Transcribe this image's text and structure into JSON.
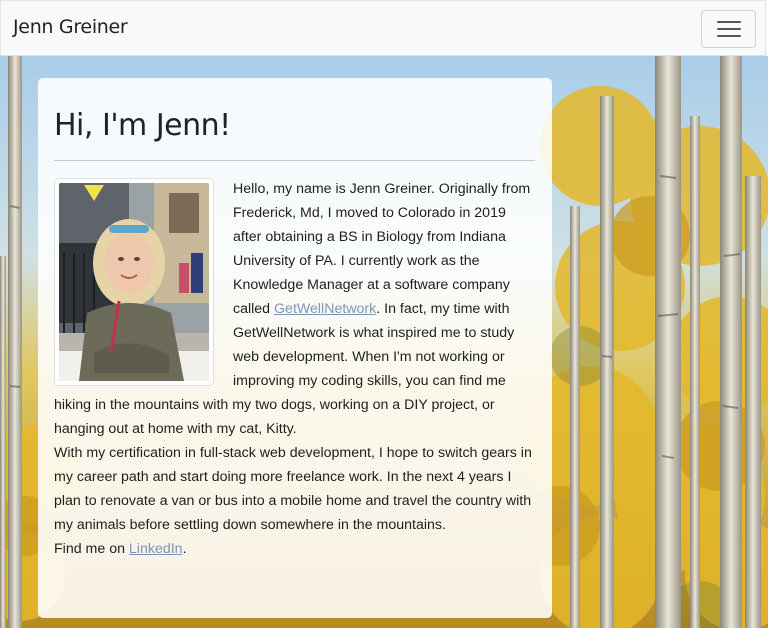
{
  "navbar": {
    "brand": "Jenn Greiner",
    "menu_icon": "hamburger-menu-icon"
  },
  "background": {
    "description_icon": "aspen-forest-background"
  },
  "card": {
    "title": "Hi, I'm Jenn!",
    "photo_icon": "profile-photo",
    "paragraph1_part1": "Hello, my name is Jenn Greiner. Originally from Frederick, Md, I moved to Colorado in 2019 after obtaining a BS in Biology from Indiana University of PA. I currently work as the Knowledge Manager at a software company called ",
    "link_getwell": "GetWellNetwork",
    "paragraph1_part2": ". In fact, my time with GetWellNetwork is what inspired me to study web development. When I'm not working or improving my coding skills, you can find me hiking in the mountains with my two dogs, working on a DIY project, or hanging out at home with my cat, Kitty.",
    "paragraph2": "With my certification in full-stack web development, I hope to switch gears in my career path and start doing more freelance work. In the next 4 years I plan to renovate a van or bus into a mobile home and travel the country with my animals before settling down somewhere in the mountains.",
    "paragraph3_part1": "Find me on ",
    "link_linkedin": "LinkedIn",
    "paragraph3_part2": "."
  },
  "colors": {
    "link": "#7f94b8",
    "navbar_bg": "#f8f9fa",
    "card_bg": "rgba(255,255,255,0.88)"
  }
}
